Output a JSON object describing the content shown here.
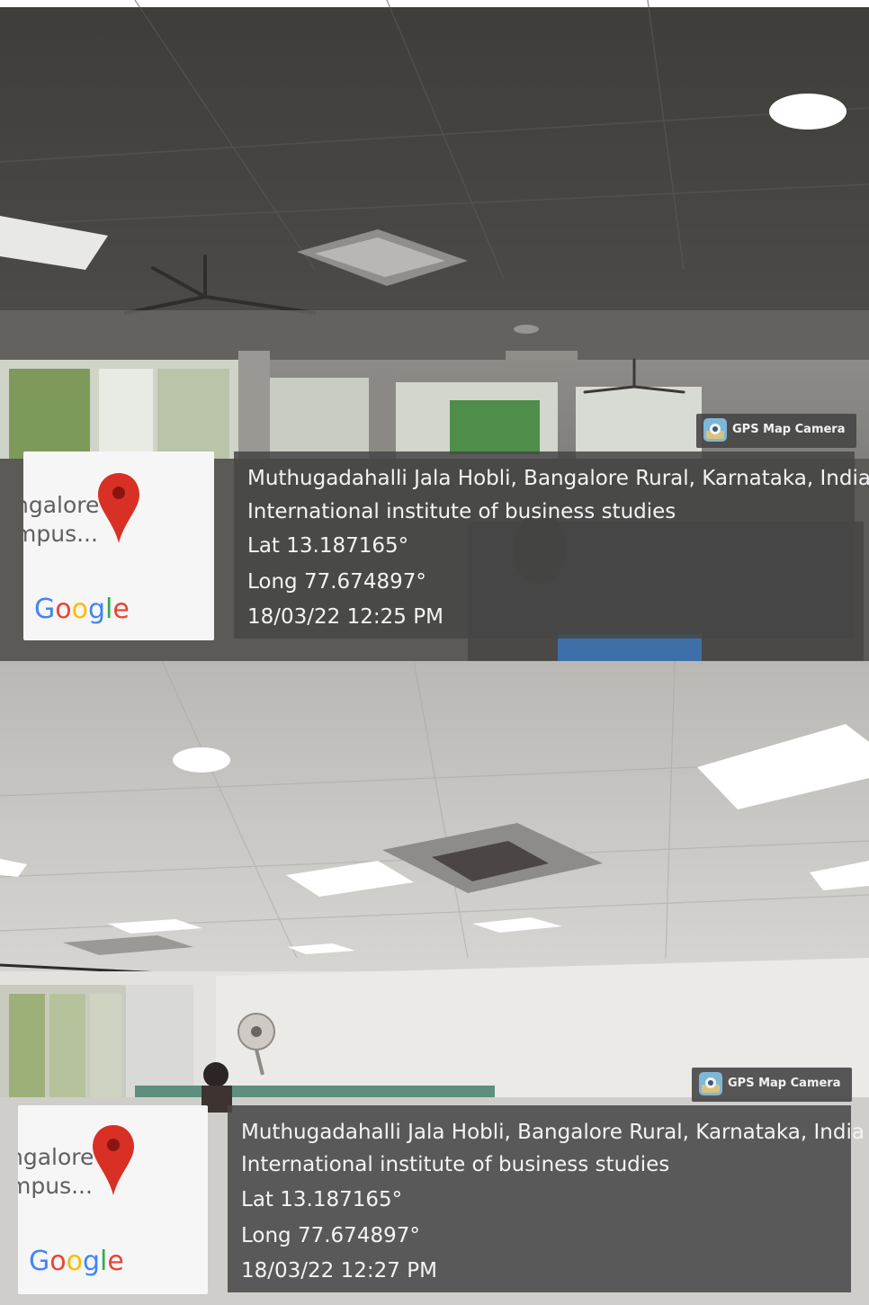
{
  "overlays": [
    {
      "badge": {
        "label": "GPS Map Camera",
        "icon": "gps-map-camera-app-icon"
      },
      "map_thumb": {
        "line1": "ngalore",
        "line2": "mpus...",
        "logo": "Google",
        "icon": "map-pin-icon"
      },
      "address": "Muthugadahalli Jala Hobli, Bangalore Rural, Karnataka, India",
      "place": "International institute of business studies",
      "lat": "Lat 13.187165°",
      "long": "Long 77.674897°",
      "datetime": "18/03/22 12:25 PM"
    },
    {
      "badge": {
        "label": "GPS Map Camera",
        "icon": "gps-map-camera-app-icon"
      },
      "map_thumb": {
        "line1": "ngalore",
        "line2": "mpus...",
        "logo": "Google",
        "icon": "map-pin-icon"
      },
      "address": "Muthugadahalli Jala Hobli, Bangalore Rural, Karnataka, India",
      "place": "International institute of business studies",
      "lat": "Lat 13.187165°",
      "long": "Long 77.674897°",
      "datetime": "18/03/22 12:27 PM"
    }
  ],
  "colors": {
    "overlay_bg": "#464646",
    "pin_red": "#d93025",
    "google_blue": "#4285f4",
    "google_red": "#ea4335",
    "google_yellow": "#fbbc05",
    "google_green": "#34a853"
  }
}
